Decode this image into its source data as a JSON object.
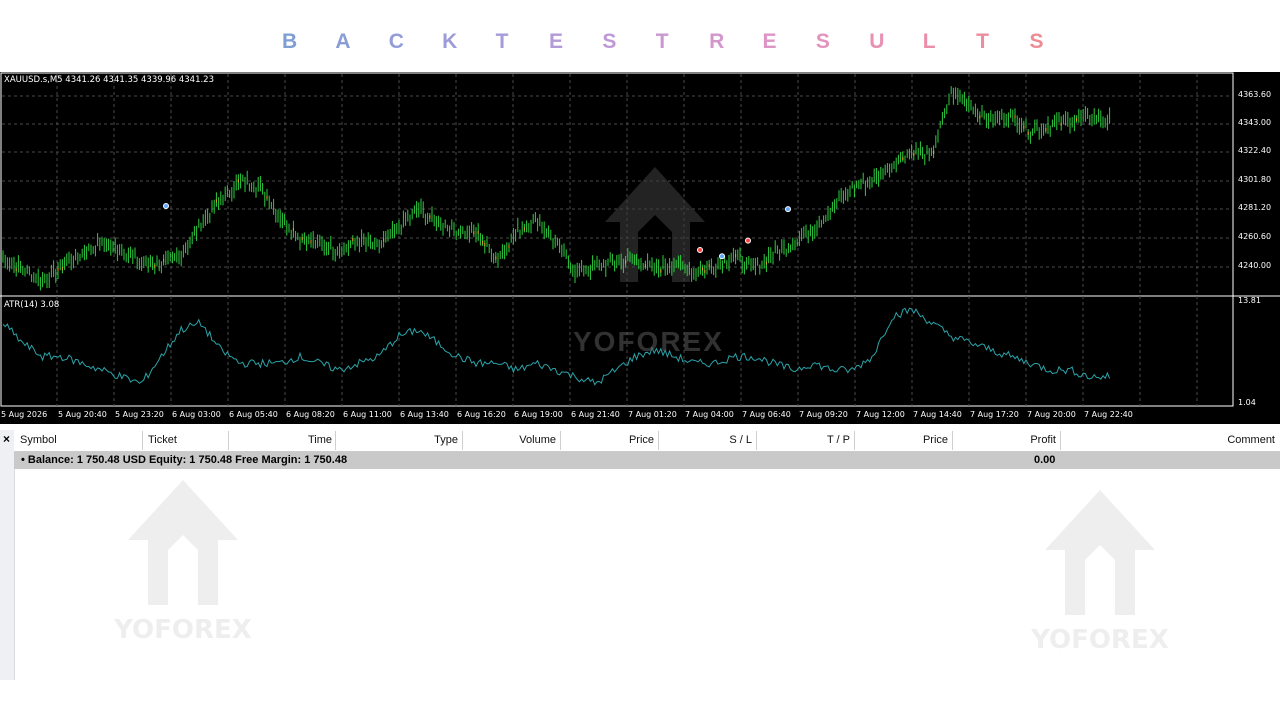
{
  "page_title": [
    "B",
    "A",
    "C",
    "K",
    "T",
    "E",
    "S",
    "T",
    "R",
    "E",
    "S",
    "U",
    "L",
    "T",
    "S"
  ],
  "title_colors": [
    "#7f9ed4",
    "#8a9ed6",
    "#939dd8",
    "#9d9cd9",
    "#a79bd9",
    "#b39ad8",
    "#be99d6",
    "#c998d2",
    "#d497cc",
    "#dd95c5",
    "#e393bd",
    "#e891b3",
    "#ea8faa",
    "#ec8d9f",
    "#ee8b94"
  ],
  "chart": {
    "symbol_info": "XAUUSD.s,M5  4341.26 4341.35 4339.96 4341.23",
    "indicator_info": "ATR(14) 3.08",
    "price_labels": [
      "4363.60",
      "4343.00",
      "4322.40",
      "4301.80",
      "4281.20",
      "4260.60",
      "4240.00"
    ],
    "atr_labels": [
      "13.81",
      "1.04"
    ],
    "time_labels": [
      "5 Aug 2026",
      "5 Aug 20:40",
      "5 Aug 23:20",
      "6 Aug 03:00",
      "6 Aug 05:40",
      "6 Aug 08:20",
      "6 Aug 11:00",
      "6 Aug 13:40",
      "6 Aug 16:20",
      "6 Aug 19:00",
      "6 Aug 21:40",
      "7 Aug 01:20",
      "7 Aug 04:00",
      "7 Aug 06:40",
      "7 Aug 09:20",
      "7 Aug 12:00",
      "7 Aug 14:40",
      "7 Aug 17:20",
      "7 Aug 20:00",
      "7 Aug 22:40"
    ],
    "watermark": "YOFOREX",
    "colors": {
      "candle": "#2ecc40",
      "atr": "#2aa3a8",
      "grid": "#4a4a4a"
    }
  },
  "chart_data": {
    "type": "line",
    "price_series": [
      4252,
      4246,
      4238,
      4248,
      4256,
      4262,
      4258,
      4250,
      4249,
      4254,
      4275,
      4290,
      4302,
      4298,
      4280,
      4266,
      4262,
      4258,
      4264,
      4260,
      4272,
      4284,
      4276,
      4270,
      4268,
      4252,
      4270,
      4278,
      4262,
      4244,
      4248,
      4250,
      4252,
      4246,
      4250,
      4244,
      4248,
      4254,
      4246,
      4256,
      4262,
      4272,
      4285,
      4298,
      4302,
      4312,
      4322,
      4318,
      4358,
      4350,
      4340,
      4344,
      4334,
      4338,
      4340,
      4343,
      4341
    ],
    "atr_series": [
      11,
      8,
      6,
      6,
      5,
      4,
      3,
      2,
      6,
      10,
      11,
      7,
      5,
      5,
      5,
      6,
      5,
      4,
      5,
      6,
      9,
      10,
      8,
      6,
      5,
      5,
      4,
      5,
      4,
      3,
      2,
      4,
      6,
      7,
      6,
      5,
      5,
      6,
      6,
      5,
      4,
      5,
      4,
      4,
      6,
      12,
      13,
      11,
      9,
      8,
      7,
      6,
      5,
      4,
      4,
      3,
      3
    ],
    "ylim": [
      4230,
      4370
    ],
    "atr_ylim": [
      1.04,
      13.81
    ]
  },
  "terminal": {
    "close": "×",
    "columns": [
      "Symbol",
      "Ticket",
      "Time",
      "Type",
      "Volume",
      "Price",
      "S / L",
      "T / P",
      "Price",
      "Profit",
      "Comment"
    ],
    "balance_text": "•  Balance: 1 750.48 USD  Equity: 1 750.48  Free Margin: 1 750.48",
    "profit": "0.00"
  }
}
